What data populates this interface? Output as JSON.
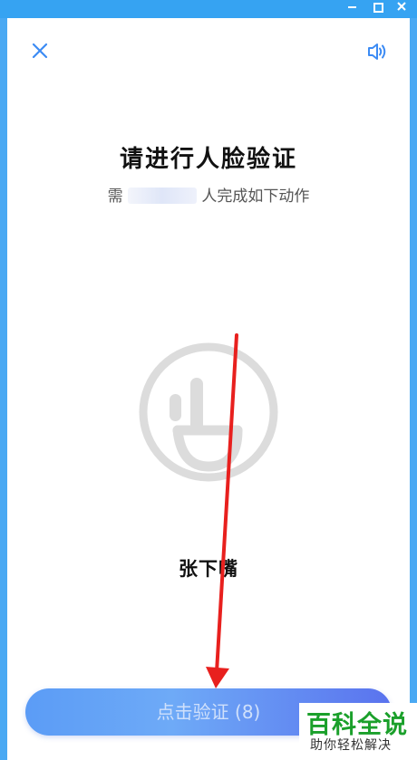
{
  "window": {
    "minimize": "minimize",
    "maximize": "maximize",
    "close": "close"
  },
  "header": {
    "close_icon": "×",
    "sound_icon": "speaker-icon"
  },
  "main": {
    "title": "请进行人脸验证",
    "subtitle_prefix": "需",
    "subtitle_suffix": "人完成如下动作",
    "action_label": "张下嘴"
  },
  "footer": {
    "verify_button": "点击验证 (8)"
  },
  "watermark": {
    "main": "百科全说",
    "sub": "助你轻松解决"
  },
  "colors": {
    "accent": "#3c8bf4",
    "button_start": "#5b9cf6",
    "button_end": "#5a73ee",
    "arrow": "#e8201e",
    "watermark_green": "#1ba02b"
  }
}
